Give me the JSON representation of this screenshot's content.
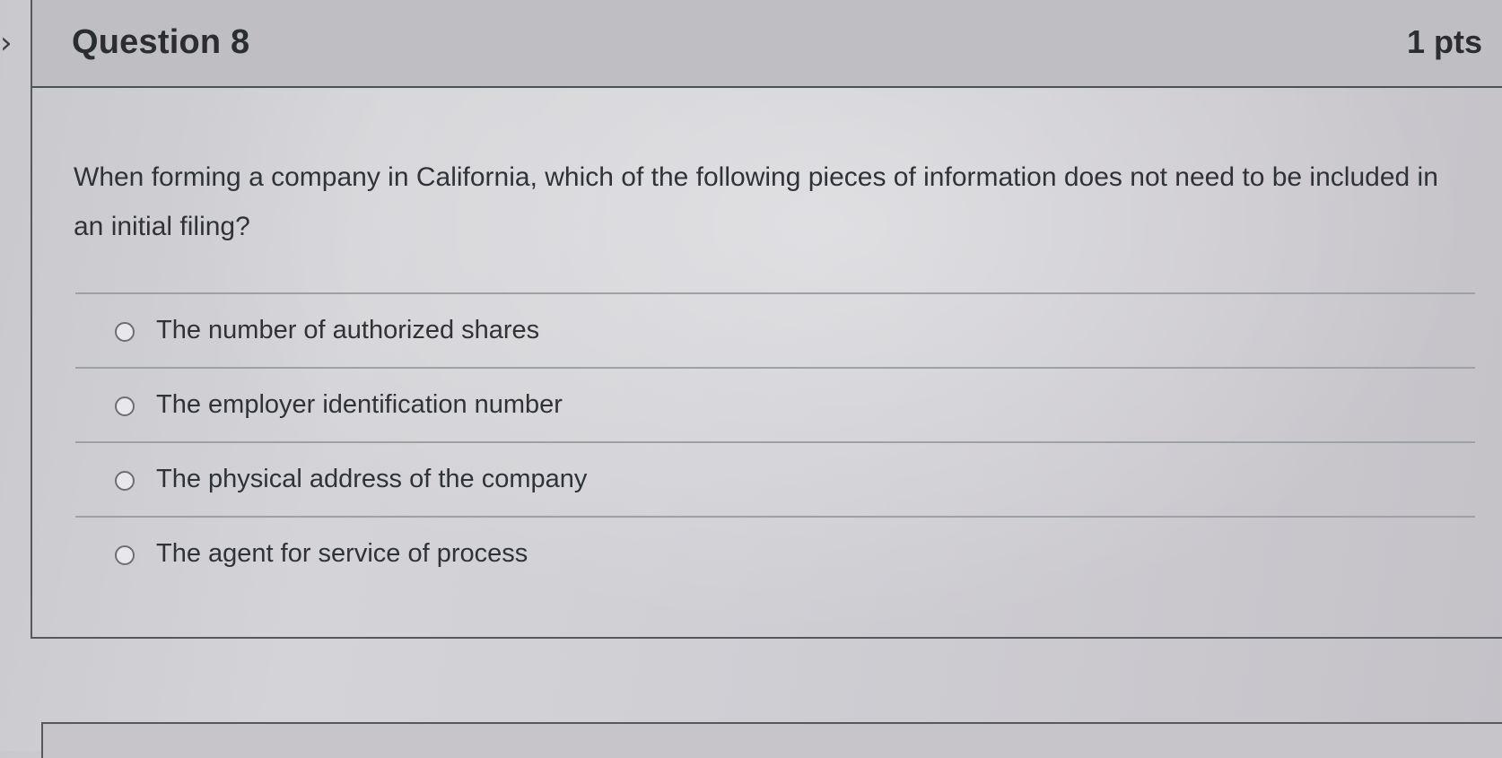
{
  "question": {
    "title": "Question 8",
    "points": "1 pts",
    "text": "When forming a company in California, which of the following pieces of information does not need to be included in an initial filing?"
  },
  "answers": [
    {
      "label": "The number of authorized shares",
      "selected": false
    },
    {
      "label": "The employer identification number",
      "selected": false
    },
    {
      "label": "The physical address of the company",
      "selected": false
    },
    {
      "label": "The agent for service of process",
      "selected": false
    }
  ],
  "icons": {
    "collapse": "chevron-right-icon"
  }
}
